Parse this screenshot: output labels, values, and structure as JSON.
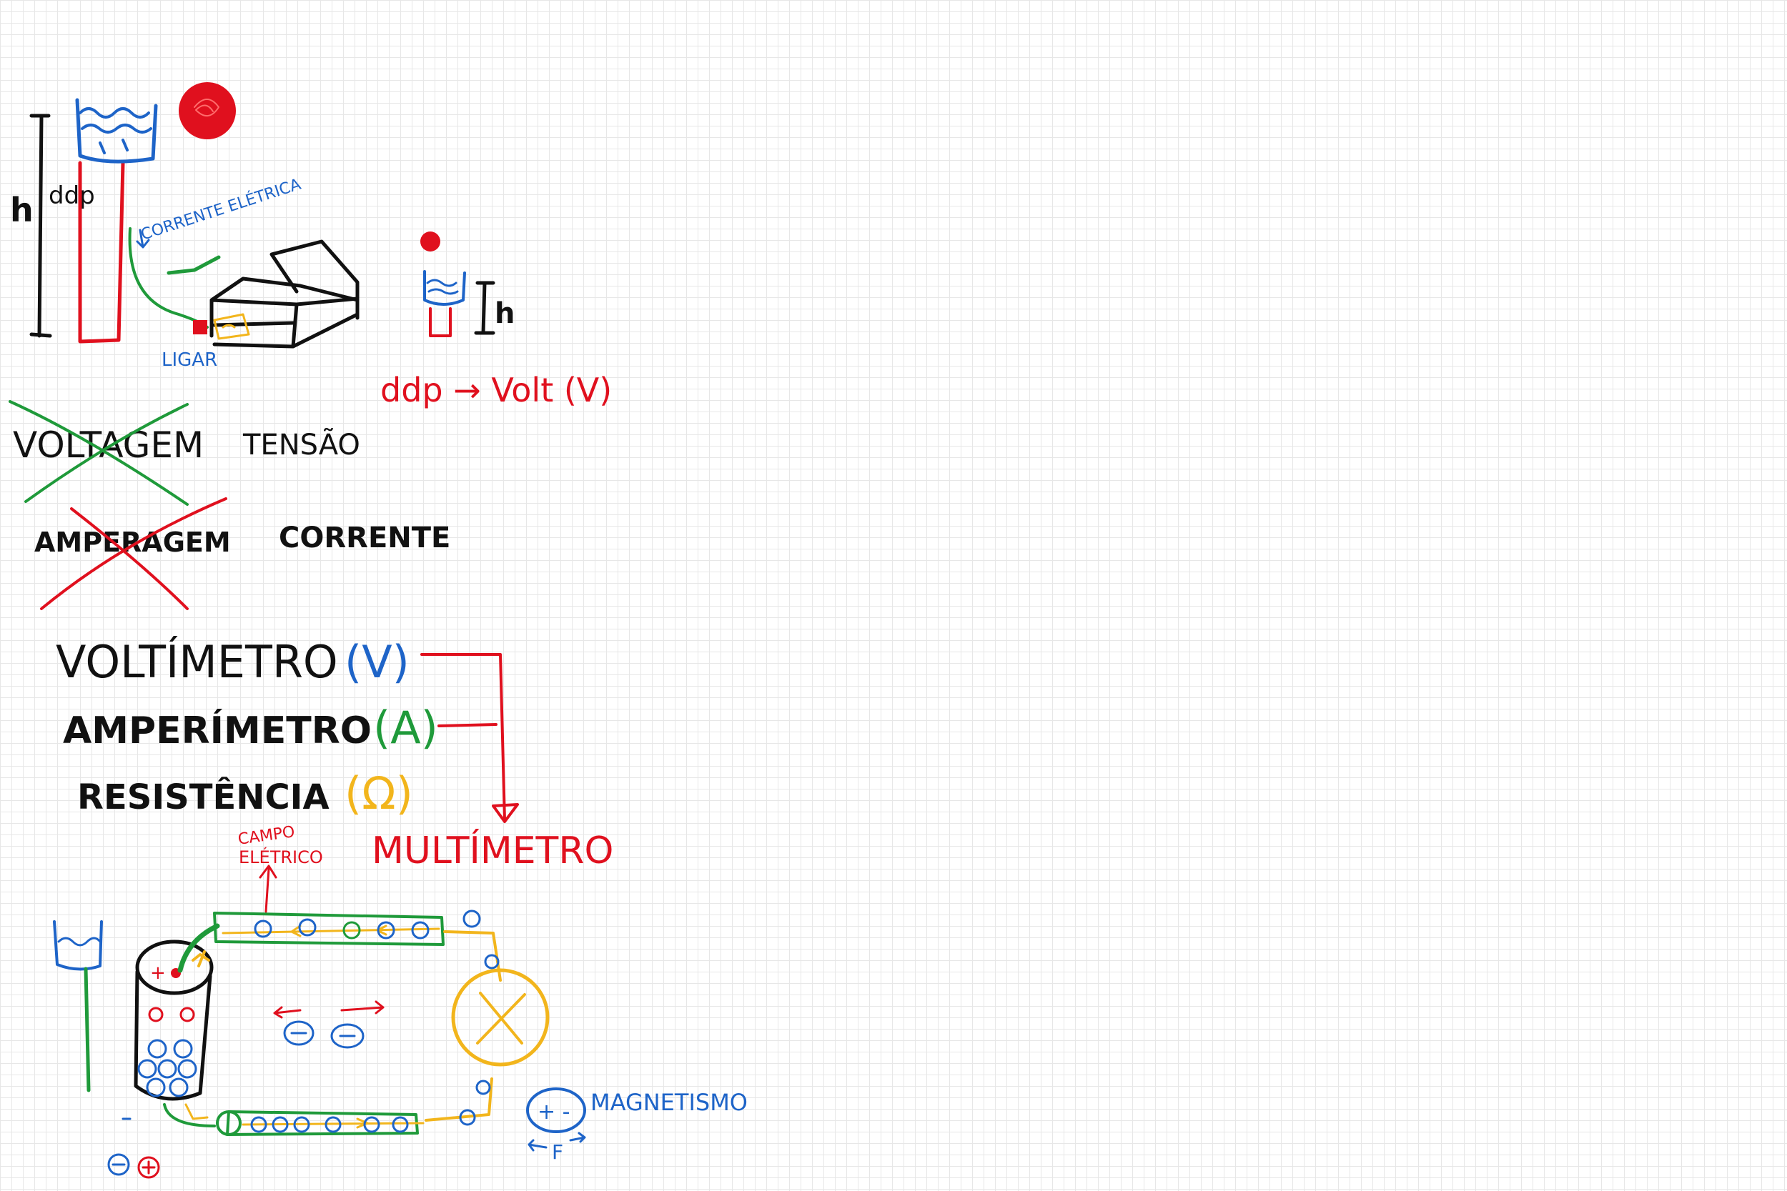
{
  "colors": {
    "black": "#111111",
    "blue": "#1e64c8",
    "red": "#e0101e",
    "green": "#1f9a3a",
    "yellow": "#f2b51c"
  },
  "tank_diagram": {
    "h_label": "h",
    "ddp_label": "ddp",
    "corrente_label": "CORRENTE ELÉTRICA",
    "ligar_label": "LIGAR",
    "small_h_label": "h",
    "ddp_volt_label": "ddp → Volt (V)"
  },
  "terms": {
    "voltagem": "VOLTAGEM",
    "tensao": "TENSÃO",
    "amperagem": "AMPERAGEM",
    "corrente": "CORRENTE"
  },
  "instruments": [
    {
      "name": "VOLTÍMETRO",
      "symbol": "(V)"
    },
    {
      "name": "AMPERÍMETRO",
      "symbol": "(A)"
    },
    {
      "name": "RESISTÊNCIA",
      "symbol": "(Ω)"
    }
  ],
  "multimetro_label": "MULTÍMETRO",
  "circuit": {
    "campo_label_line1": "CAMPO",
    "campo_label_line2": "ELÉTRICO",
    "plus_sign": "+",
    "magnetismo_label": "MAGNETISMO",
    "magnet_symbol": "+ -",
    "force_label": "F"
  }
}
